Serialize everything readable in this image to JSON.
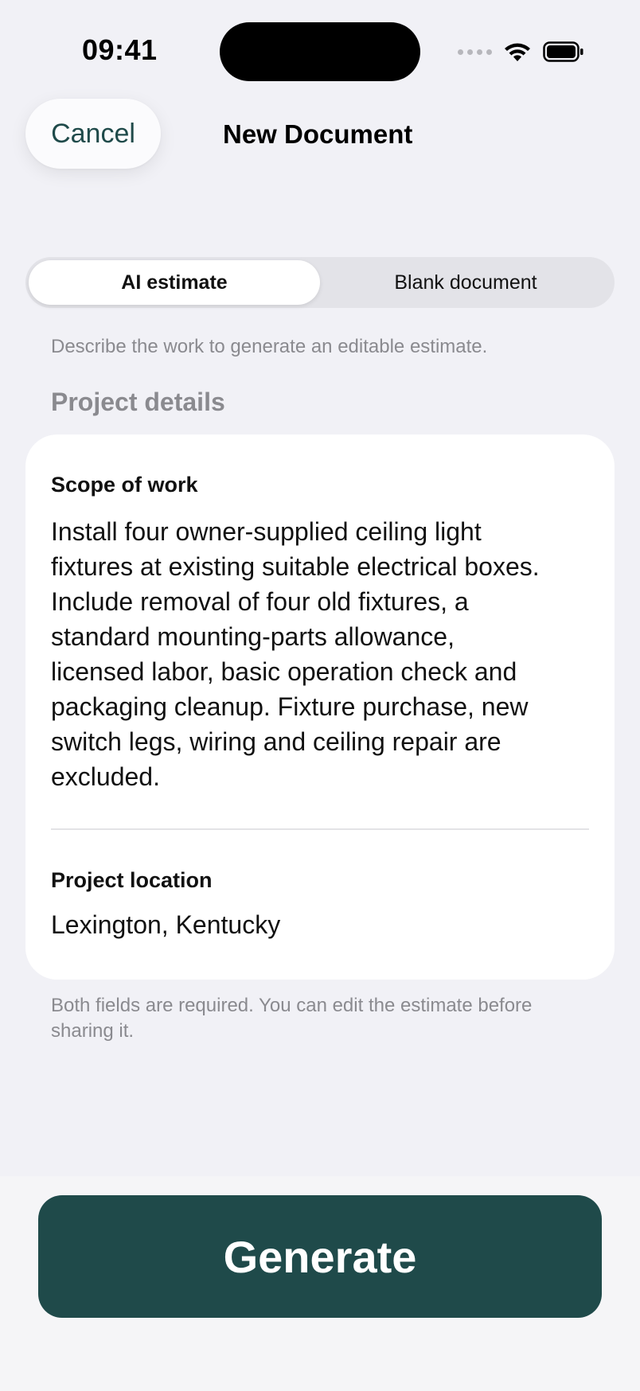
{
  "status_bar": {
    "time": "09:41",
    "icons": [
      "cellular-signal-icon",
      "wifi-icon",
      "battery-icon"
    ]
  },
  "nav": {
    "cancel_label": "Cancel",
    "title": "New Document"
  },
  "segmented": {
    "options": [
      "AI estimate",
      "Blank document"
    ],
    "selected": "AI estimate"
  },
  "hint": "Describe the work to generate an editable estimate.",
  "section_title": "Project details",
  "form": {
    "scope_label": "Scope of work",
    "scope_value": "Install four owner-supplied ceiling light\nfixtures at existing suitable electrical boxes.\nInclude removal of four old fixtures, a\nstandard mounting-parts allowance,\nlicensed labor, basic operation check and\npackaging cleanup. Fixture purchase, new\nswitch legs, wiring and ceiling repair are\nexcluded.",
    "location_label": "Project location",
    "location_value": "Lexington, Kentucky"
  },
  "footnote": "Both fields are required. You can edit the estimate before sharing it.",
  "generate_label": "Generate",
  "colors": {
    "accent": "#1f4a4a",
    "background": "#f1f1f6",
    "secondary_text": "#8a8a8f"
  }
}
